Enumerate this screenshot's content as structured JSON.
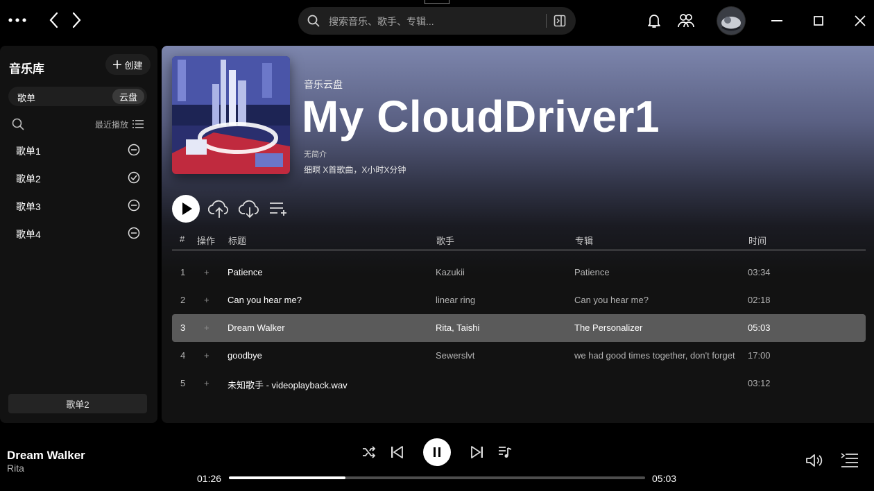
{
  "topbar": {
    "search_placeholder": "搜索音乐、歌手、专辑..."
  },
  "sidebar": {
    "title": "音乐库",
    "create_label": "创建",
    "toggle": {
      "left": "歌单",
      "right": "云盘"
    },
    "recent_label": "最近播放",
    "items": [
      {
        "label": "歌单1",
        "icon": "minus-circle-icon"
      },
      {
        "label": "歌单2",
        "icon": "check-circle-icon"
      },
      {
        "label": "歌单3",
        "icon": "minus-circle-icon"
      },
      {
        "label": "歌单4",
        "icon": "minus-circle-icon"
      }
    ],
    "footer_label": "歌单2"
  },
  "main": {
    "kind": "音乐云盘",
    "title": "My CloudDriver1",
    "description": "无简介",
    "meta": "细暝 X首歌曲，X小时X分钟",
    "headers": {
      "num": "#",
      "op": "操作",
      "title": "标题",
      "artist": "歌手",
      "album": "专辑",
      "time": "时间"
    },
    "tracks": [
      {
        "num": "1",
        "op": "+",
        "title": "Patience",
        "artist": "Kazukii",
        "album": "Patience",
        "time": "03:34"
      },
      {
        "num": "2",
        "op": "+",
        "title": "Can you hear me?",
        "artist": "linear ring",
        "album": "Can you hear me?",
        "time": "02:18"
      },
      {
        "num": "3",
        "op": "+",
        "title": "Dream Walker",
        "artist": "Rita, Taishi",
        "album": "The Personalizer",
        "time": "05:03",
        "selected": true
      },
      {
        "num": "4",
        "op": "+",
        "title": "goodbye",
        "artist": "Sewerslvt",
        "album": "we had good times together, don't forget",
        "time": "17:00"
      },
      {
        "num": "5",
        "op": "+",
        "title": "未知歌手 - videoplayback.wav",
        "artist": "",
        "album": "",
        "time": "03:12"
      }
    ]
  },
  "player": {
    "title": "Dream Walker",
    "artist": "Rita",
    "current_time": "01:26",
    "duration": "05:03",
    "progress": 0.28
  },
  "colors": {
    "background": "#000000",
    "panel": "#121212",
    "header_gradient_top": "#7d86ad",
    "selected_row": "#5a5a5a"
  }
}
